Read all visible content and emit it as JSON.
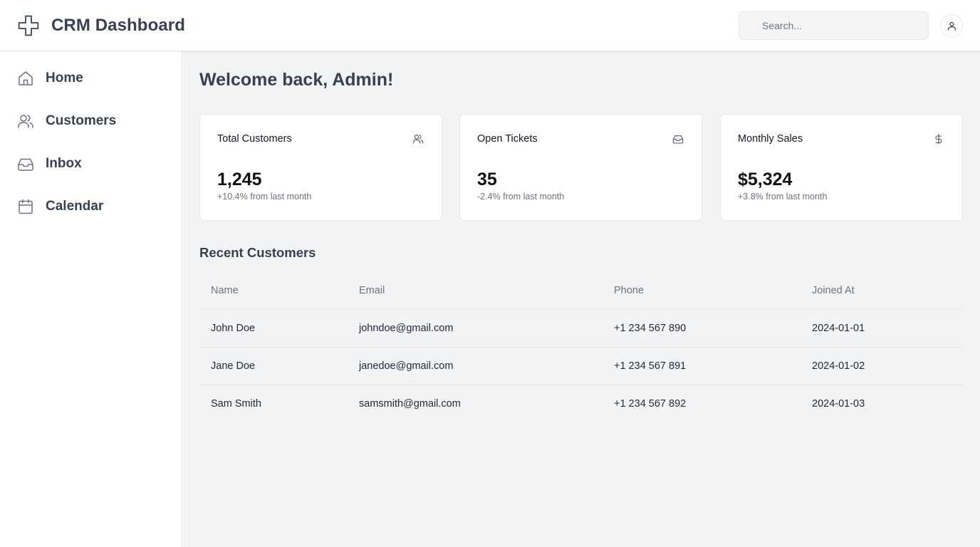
{
  "app": {
    "title": "CRM Dashboard",
    "logo_icon": "plus-icon"
  },
  "header": {
    "search": {
      "placeholder": "Search...",
      "value": ""
    },
    "user_icon": "user-icon"
  },
  "sidebar": {
    "items": [
      {
        "label": "Home",
        "icon": "home-icon"
      },
      {
        "label": "Customers",
        "icon": "users-icon"
      },
      {
        "label": "Inbox",
        "icon": "inbox-icon"
      },
      {
        "label": "Calendar",
        "icon": "calendar-icon"
      }
    ]
  },
  "main": {
    "welcome": "Welcome back, Admin!",
    "cards": [
      {
        "title": "Total Customers",
        "value": "1,245",
        "subtitle": "+10.4% from last month",
        "icon": "users-icon"
      },
      {
        "title": "Open Tickets",
        "value": "35",
        "subtitle": "-2.4% from last month",
        "icon": "inbox-icon"
      },
      {
        "title": "Monthly Sales",
        "value": "$5,324",
        "subtitle": "+3.8% from last month",
        "icon": "dollar-icon"
      }
    ],
    "recent_title": "Recent Customers",
    "table": {
      "columns": [
        "Name",
        "Email",
        "Phone",
        "Joined At"
      ],
      "rows": [
        [
          "John Doe",
          "johndoe@gmail.com",
          "+1 234 567 890",
          "2024-01-01"
        ],
        [
          "Jane Doe",
          "janedoe@gmail.com",
          "+1 234 567 891",
          "2024-01-02"
        ],
        [
          "Sam Smith",
          "samsmith@gmail.com",
          "+1 234 567 892",
          "2024-01-03"
        ]
      ]
    }
  },
  "colors": {
    "text_dark": "#374151",
    "text_muted": "#6b7280",
    "main_bg": "#f2f3f5",
    "border": "#e5e7eb"
  }
}
